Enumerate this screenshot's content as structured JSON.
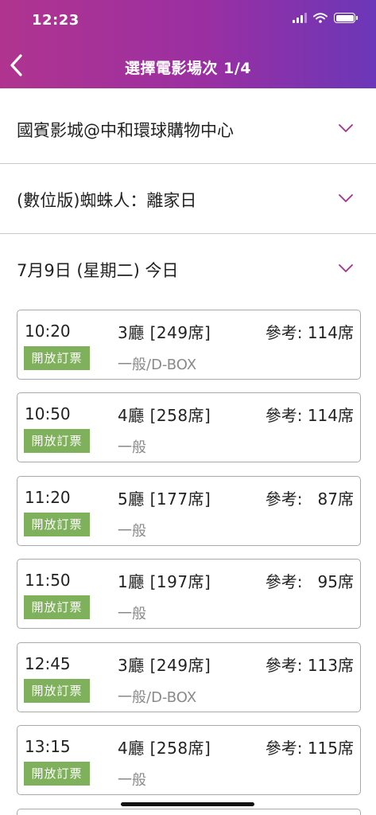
{
  "status_bar": {
    "time": "12:23"
  },
  "header": {
    "title": "選擇電影場次 1/4",
    "back_icon": "chevron-left-icon"
  },
  "colors": {
    "accent": "#9b30a0",
    "status_green": "#7fb05c",
    "chevron": "#a6308f"
  },
  "selectors": [
    {
      "label": "國賓影城@中和環球購物中心"
    },
    {
      "label": "(數位版)蜘蛛人：離家日"
    },
    {
      "label": "7月9日 (星期二) 今日"
    }
  ],
  "showtimes": [
    {
      "time": "10:20",
      "hall": "3廳 [249席]",
      "seats": "參考: 114席",
      "status": "開放訂票",
      "format": "一般/D-BOX"
    },
    {
      "time": "10:50",
      "hall": "4廳 [258席]",
      "seats": "參考: 114席",
      "status": "開放訂票",
      "format": "一般"
    },
    {
      "time": "11:20",
      "hall": "5廳 [177席]",
      "seats": "參考:   87席",
      "status": "開放訂票",
      "format": "一般"
    },
    {
      "time": "11:50",
      "hall": "1廳 [197席]",
      "seats": "參考:   95席",
      "status": "開放訂票",
      "format": "一般"
    },
    {
      "time": "12:45",
      "hall": "3廳 [249席]",
      "seats": "參考: 113席",
      "status": "開放訂票",
      "format": "一般/D-BOX"
    },
    {
      "time": "13:15",
      "hall": "4廳 [258席]",
      "seats": "參考: 115席",
      "status": "開放訂票",
      "format": "一般"
    }
  ]
}
